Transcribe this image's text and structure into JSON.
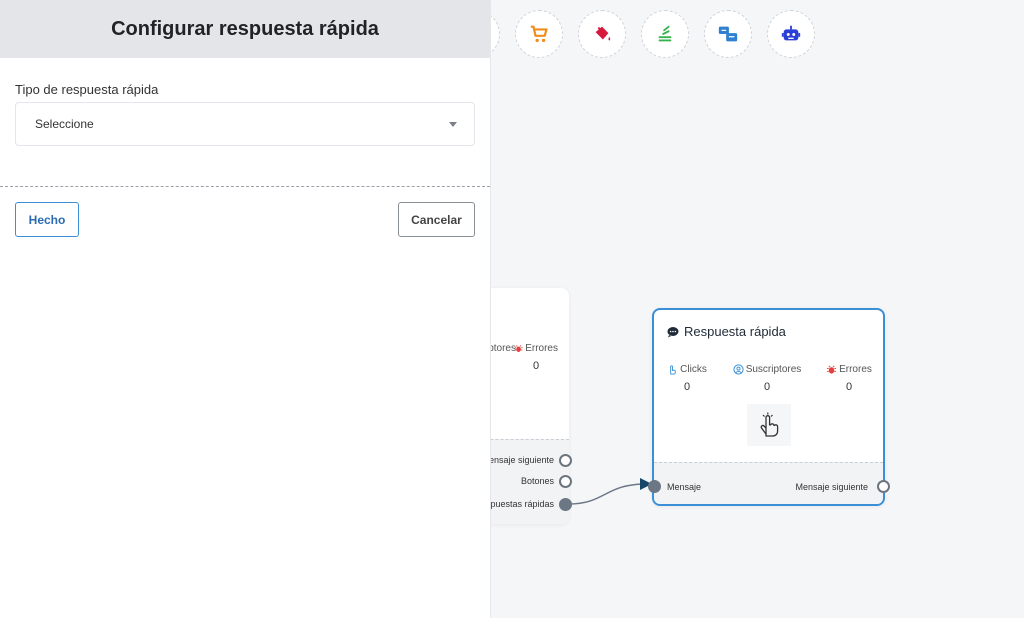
{
  "panel": {
    "title": "Configurar respuesta rápida",
    "field_label": "Tipo de respuesta rápida",
    "select_value": "Seleccione",
    "done_label": "Hecho",
    "cancel_label": "Cancelar"
  },
  "toolbar": {
    "icons": [
      "cart-icon",
      "paint-bucket-icon",
      "stack-icon",
      "chat-transfer-icon",
      "robot-icon"
    ]
  },
  "left_node": {
    "stats": [
      {
        "label": "ptores",
        "value": ""
      },
      {
        "label": "Errores",
        "value": "0"
      }
    ],
    "ports": [
      "ensaje siguiente",
      "Botones",
      "spuestas rápidas"
    ]
  },
  "right_node": {
    "title": "Respuesta rápida",
    "stats": [
      {
        "label": "Clicks",
        "value": "0"
      },
      {
        "label": "Suscriptores",
        "value": "0"
      },
      {
        "label": "Errores",
        "value": "0"
      }
    ],
    "input_label": "Mensaje",
    "output_label": "Mensaje siguiente"
  },
  "colors": {
    "accent": "#3a8fd6",
    "error": "#e53e3e",
    "clicks": "#3a8fd6",
    "cart": "#f28c1b",
    "paint": "#d6183d",
    "stack": "#37b24d",
    "transfer": "#2f80d1",
    "robot": "#2b3fd6"
  }
}
